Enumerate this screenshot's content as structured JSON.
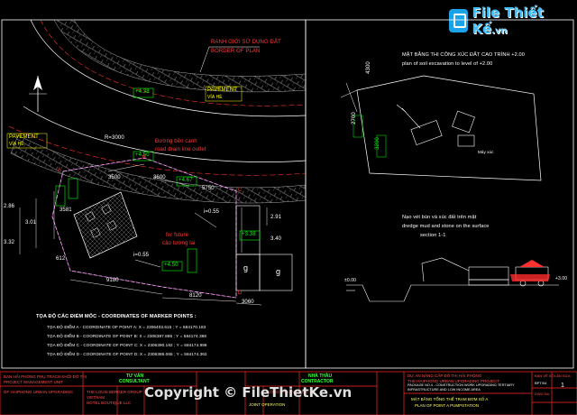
{
  "watermark": {
    "logo_text": "File Thiết Kế",
    "logo_suffix": ".vn",
    "copyright": "Copyright © FileThietKe.vn"
  },
  "left_plan": {
    "boundary_vi": "RANH GIỚI SỬ DỤNG ĐẤT",
    "boundary_en": "BORDER OF PLAN",
    "pavement_a": "PAVEMENT",
    "pavement_a_vi": "VỈA HÈ",
    "pavement_b": "PAVEMENT",
    "pavement_b_vi": "VỈA HÈ",
    "road_vi": "Đường bên cạnh",
    "road_en": "road drain line outlet",
    "future_vi": "for future",
    "future_en": "cảo tương lai",
    "labels": {
      "l438": "+4.38",
      "l450a": "+4.50",
      "l450b": "+4.50",
      "l467": "+4.67",
      "l338": "+3.38",
      "r3000": "R=3000",
      "d3500": "3500",
      "d3600": "3600",
      "d5750": "5750",
      "d3581": "3581",
      "d9180": "9180",
      "d8120": "8120",
      "d3060": "3060",
      "d612": "612",
      "d286": "2.86",
      "d301": "3.01",
      "d332": "3.32",
      "d291": "2.91",
      "d340": "3.40",
      "i055a": "i=0.55",
      "i055b": "i=0.55",
      "g1": "g",
      "g2": "g",
      "bA": "A",
      "bB": "B",
      "bC": "C",
      "bD": "D"
    },
    "coord_title": "TỌA ĐỘ CÁC ĐIỂM MỐC - COORDINATES OF MARKER POINTS :",
    "coords": [
      "TỌA ĐỘ ĐIỂM A - COORDINATE OF POINT A: X = 2306403.615 ; Y = 584170.183",
      "TỌA ĐỘ ĐIỂM B - COORDINATE OF POINT B: X = 2306397.886 ; Y = 584174.368",
      "TỌA ĐỘ ĐIỂM C - COORDINATE OF POINT C: X = 2306390.192 ; Y = 584174.996",
      "TỌA ĐỘ ĐIỂM D - COORDINATE OF POINT D: X = 2306386.065 ; Y = 584174.362"
    ]
  },
  "right_plan": {
    "title_vi": "MẶT BẰNG THI CÔNG XÚC ĐẤT CAO TRÌNH +2.00",
    "title_en": "plan of soil excavation to level of +2.00",
    "dim_4300": "4300",
    "dim_2700": "2700",
    "dim_3200": "3200",
    "section_vi": "Nạo vét bùn và xúc đất trên mặt",
    "section_en": "dredge mud and stone on the surface",
    "section_label": "section 1-1",
    "level_300": "+3.00",
    "level_ground": "±0.00",
    "excavator_label": "Máy xúc"
  },
  "title_block": {
    "owner_vi": "BAN HẢI PHÒNG PHỤ TRÁCH KHỐI ĐÔ THỊ",
    "owner_en": "PROJECT MANAGEMENT UNIT",
    "owner_sub": "OF HAIPHONG URBAN UPGRADING",
    "consultant_vi": "TƯ VẤN",
    "consultant_en": "CONSULTANT",
    "consultant_firm": "THE LOUIS BERGER GROUP",
    "consultant_firm2": "VIETNAM",
    "consultant_firm3": "HOTEL BOUTIQUE LLC",
    "contractor_vi": "NHÀ THẦU",
    "contractor_en": "CONTRACTOR",
    "contractor_firm": "CÔNG TY XÂY DỰNG",
    "joint_op": "JOINT OPERATION",
    "project_vi": "DỰ ÁN NÂNG CẤP ĐÔ THỊ HẢI PHÒNG",
    "project_en": "THE HAIPHONG URBAN UPGRADING PROJECT",
    "project_sub": "PACKAGE NO.4 - CONSTRUCTION WORK UPGRADING TERTIARY",
    "project_sub2": "INFRASTRUCTURE AND LOW INCOME AREA",
    "drawing_vi": "MẶT BẰNG TỔNG THỂ TRẠM BƠM SỐ A",
    "drawing_en": "PLAN OF POINT A PUMPSTATION",
    "sheet_label": "BẢN VẼ SỐ",
    "sheet_no": "BPT/04",
    "sheet_label2": "DWG No.",
    "rev_label": "LẦN SỬA",
    "rev_no": "1"
  }
}
